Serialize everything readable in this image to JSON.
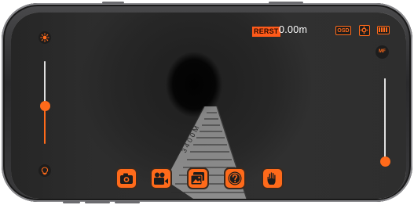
{
  "status_bar": {
    "reset_label": "RERST",
    "distance": "0.00m",
    "osd_label": "OSD"
  },
  "left_controls": {
    "brightness_icon": "brightness-icon",
    "light_off_icon": "bulb-icon",
    "brightness_level": 0.5
  },
  "right_controls": {
    "mf_label": "MF",
    "focus_level": 0.0
  },
  "toolbar": {
    "buttons": [
      {
        "icon": "camera-icon"
      },
      {
        "icon": "video-record-icon"
      },
      {
        "icon": "gallery-icon"
      },
      {
        "icon": "help-icon"
      },
      {
        "icon": "hand-icon"
      }
    ]
  },
  "colors": {
    "accent": "#ff6a1a",
    "badge_bg": "#1d1d1d",
    "text": "#ffffff"
  },
  "tape_markings": "3 4 0 0 M"
}
